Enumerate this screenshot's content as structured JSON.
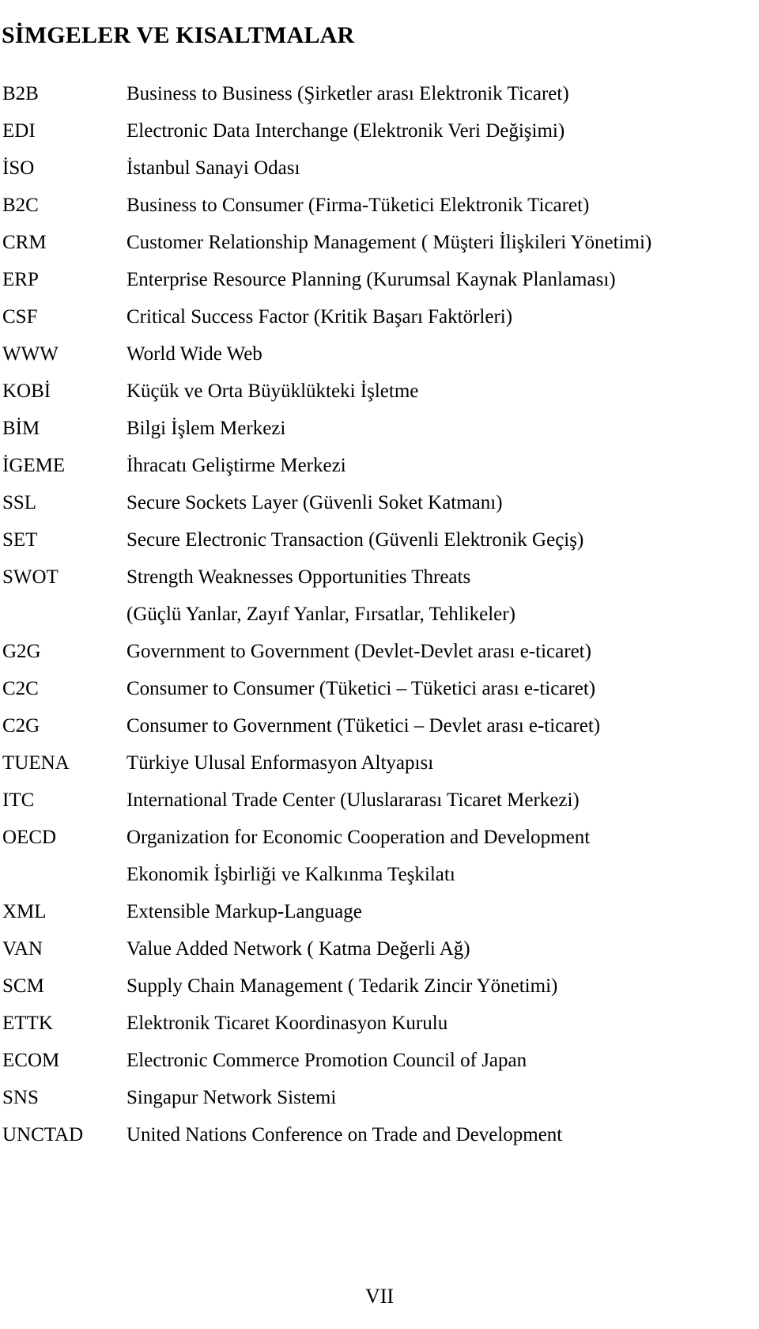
{
  "document": {
    "title": "SİMGELER VE KISALTMALAR",
    "page_number": "VII"
  },
  "abbreviations": [
    {
      "term": "B2B",
      "definition": "Business to Business (Şirketler arası Elektronik Ticaret)",
      "continuation": false
    },
    {
      "term": "EDI",
      "definition": "Electronic Data Interchange (Elektronik Veri Değişimi)",
      "continuation": false
    },
    {
      "term": "İSO",
      "definition": "İstanbul Sanayi Odası",
      "continuation": false
    },
    {
      "term": "B2C",
      "definition": "Business to Consumer (Firma-Tüketici Elektronik Ticaret)",
      "continuation": false
    },
    {
      "term": "CRM",
      "definition": "Customer Relationship Management ( Müşteri İlişkileri Yönetimi)",
      "continuation": false
    },
    {
      "term": "ERP",
      "definition": "Enterprise Resource Planning (Kurumsal Kaynak Planlaması)",
      "continuation": false
    },
    {
      "term": "CSF",
      "definition": "Critical Success Factor (Kritik Başarı Faktörleri)",
      "continuation": false
    },
    {
      "term": "WWW",
      "definition": "World Wide Web",
      "continuation": false
    },
    {
      "term": "KOBİ",
      "definition": "Küçük ve Orta Büyüklükteki İşletme",
      "continuation": false
    },
    {
      "term": "BİM",
      "definition": "Bilgi İşlem Merkezi",
      "continuation": false
    },
    {
      "term": "İGEME",
      "definition": "İhracatı Geliştirme Merkezi",
      "continuation": false
    },
    {
      "term": "SSL",
      "definition": "Secure Sockets Layer (Güvenli Soket Katmanı)",
      "continuation": false
    },
    {
      "term": "SET",
      "definition": "Secure Electronic Transaction (Güvenli Elektronik Geçiş)",
      "continuation": false
    },
    {
      "term": "SWOT",
      "definition": "Strength Weaknesses Opportunities Threats",
      "continuation": false
    },
    {
      "term": "",
      "definition": "(Güçlü Yanlar, Zayıf Yanlar, Fırsatlar, Tehlikeler)",
      "continuation": true
    },
    {
      "term": "G2G",
      "definition": "Government to Government (Devlet-Devlet arası e-ticaret)",
      "continuation": false
    },
    {
      "term": "C2C",
      "definition": "Consumer to Consumer (Tüketici – Tüketici arası e-ticaret)",
      "continuation": false
    },
    {
      "term": "C2G",
      "definition": "Consumer to Government (Tüketici – Devlet arası e-ticaret)",
      "continuation": false
    },
    {
      "term": "TUENA",
      "definition": "Türkiye Ulusal Enformasyon Altyapısı",
      "continuation": false
    },
    {
      "term": "ITC",
      "definition": "International Trade Center (Uluslararası Ticaret Merkezi)",
      "continuation": false
    },
    {
      "term": "OECD",
      "definition": "Organization for Economic Cooperation and Development",
      "continuation": false
    },
    {
      "term": "",
      "definition": "Ekonomik İşbirliği ve Kalkınma Teşkilatı",
      "continuation": true
    },
    {
      "term": "XML",
      "definition": "Extensible Markup-Language",
      "continuation": false
    },
    {
      "term": "VAN",
      "definition": "Value Added Network ( Katma Değerli Ağ)",
      "continuation": false
    },
    {
      "term": "SCM",
      "definition": "Supply Chain Management ( Tedarik Zincir Yönetimi)",
      "continuation": false
    },
    {
      "term": "ETTK",
      "definition": "Elektronik Ticaret Koordinasyon Kurulu",
      "continuation": false
    },
    {
      "term": "ECOM",
      "definition": "Electronic Commerce Promotion Council of Japan",
      "continuation": false
    },
    {
      "term": "SNS",
      "definition": "Singapur Network Sistemi",
      "continuation": false
    },
    {
      "term": "UNCTAD",
      "definition": "United Nations Conference on Trade and Development",
      "continuation": false
    }
  ]
}
